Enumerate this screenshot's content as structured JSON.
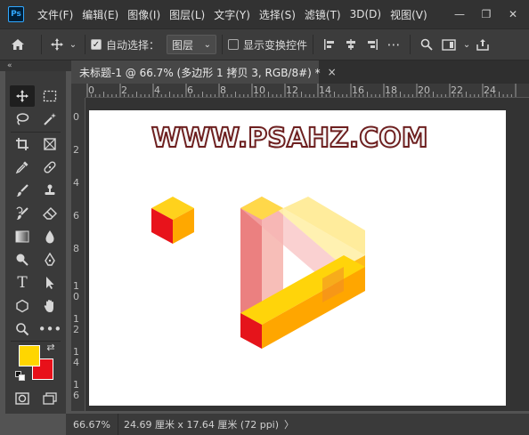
{
  "menubar": {
    "logo": "Ps",
    "items": [
      "文件(F)",
      "编辑(E)",
      "图像(I)",
      "图层(L)",
      "文字(Y)",
      "选择(S)",
      "滤镜(T)",
      "3D(D)",
      "视图(V)"
    ],
    "minimize_glyph": "—",
    "restore_glyph": "❐",
    "close_glyph": "✕"
  },
  "options": {
    "auto_select_label": "自动选择：",
    "layer_value": "图层",
    "show_transform_label": "显示变换控件"
  },
  "panel_toggle": "«",
  "document": {
    "tab_title": "未标题-1 @ 66.7% (多边形 1 拷贝 3, RGB/8#) *",
    "close_glyph": "×",
    "watermark": "WWW.PSAHZ.COM"
  },
  "rulers": {
    "top": [
      "0",
      "2",
      "4",
      "6",
      "8",
      "10",
      "12",
      "14",
      "16",
      "18",
      "20",
      "22",
      "24"
    ],
    "left": [
      "0",
      "2",
      "4",
      "6",
      "8",
      "1",
      "0",
      "1",
      "2",
      "1",
      "4",
      "1",
      "6"
    ]
  },
  "swatches": {
    "foreground": "#ffd600",
    "background": "#e8101a"
  },
  "status": {
    "zoom": "66.67%",
    "doc_size": "24.69 厘米 x 17.64 厘米 (72 ppi)",
    "arrow": "〉"
  }
}
